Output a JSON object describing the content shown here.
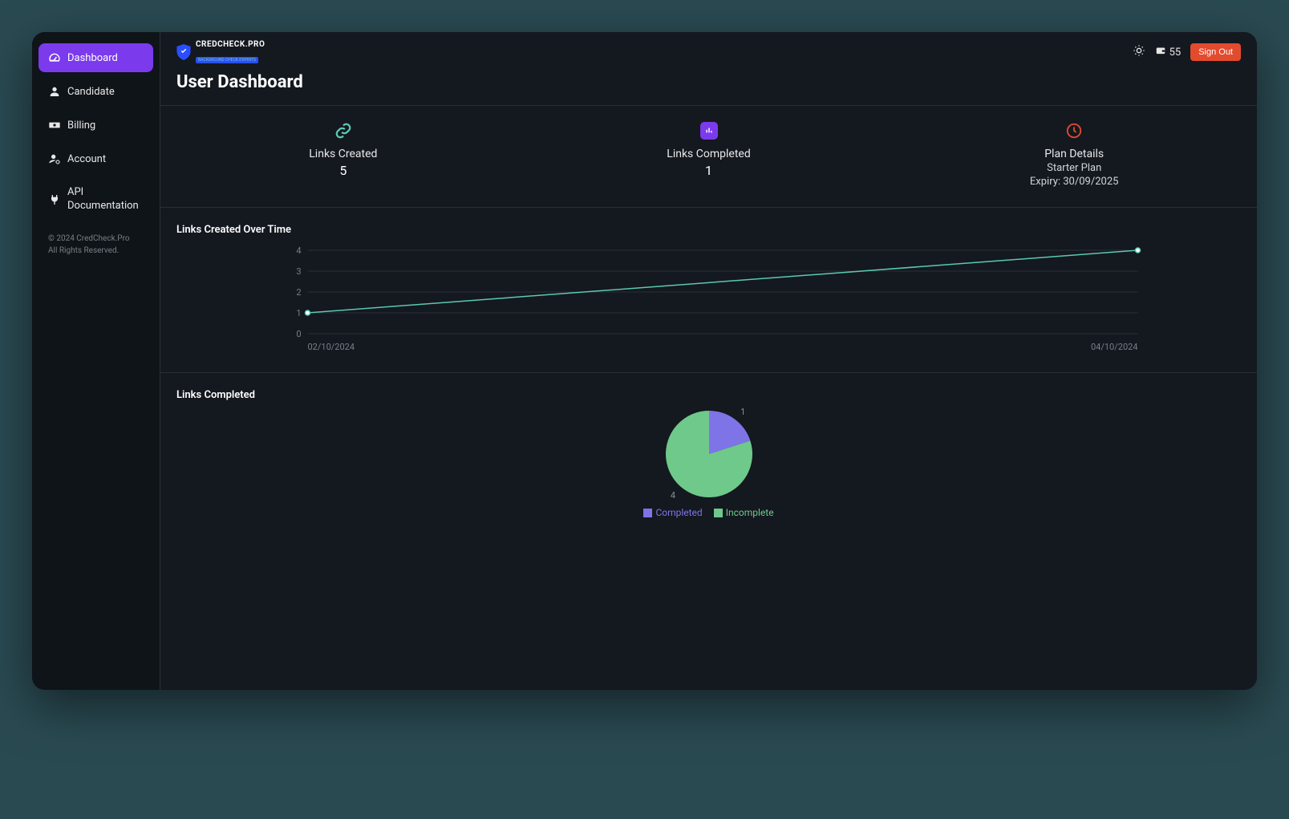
{
  "sidebar": {
    "items": [
      {
        "label": "Dashboard",
        "icon": "gauge-icon",
        "active": true
      },
      {
        "label": "Candidate",
        "icon": "user-icon",
        "active": false
      },
      {
        "label": "Billing",
        "icon": "money-icon",
        "active": false
      },
      {
        "label": "Account",
        "icon": "user-gear-icon",
        "active": false
      },
      {
        "label": "API Documentation",
        "icon": "plug-icon",
        "active": false
      }
    ],
    "footer_line1": "© 2024 CredCheck.Pro",
    "footer_line2": "All Rights Reserved."
  },
  "brand": {
    "name": "CREDCHECK.PRO",
    "tagline": "BACKGROUND CHECK EXPERTS"
  },
  "topbar": {
    "credits": "55",
    "signout_label": "Sign Out"
  },
  "page": {
    "title": "User Dashboard"
  },
  "stats": {
    "links_created": {
      "label": "Links Created",
      "value": "5"
    },
    "links_completed": {
      "label": "Links Completed",
      "value": "1"
    },
    "plan_details": {
      "label": "Plan Details",
      "plan_name": "Starter Plan",
      "expiry": "Expiry: 30/09/2025"
    }
  },
  "chart_data": [
    {
      "type": "line",
      "title": "Links Created Over Time",
      "x": [
        "02/10/2024",
        "04/10/2024"
      ],
      "values": [
        1,
        4
      ],
      "ylim": [
        0,
        4
      ],
      "yticks": [
        0,
        1,
        2,
        3,
        4
      ],
      "xlabel": "",
      "ylabel": "",
      "color": "#5ac9b0"
    },
    {
      "type": "pie",
      "title": "Links Completed",
      "series": [
        {
          "name": "Completed",
          "value": 1,
          "color": "#7e74e8"
        },
        {
          "name": "Incomplete",
          "value": 4,
          "color": "#6ec98a"
        }
      ]
    }
  ],
  "colors": {
    "accent": "#7c3aed",
    "teal": "#5ac9b0",
    "red": "#e34b2e",
    "green": "#6ec98a",
    "purple": "#7e74e8"
  }
}
